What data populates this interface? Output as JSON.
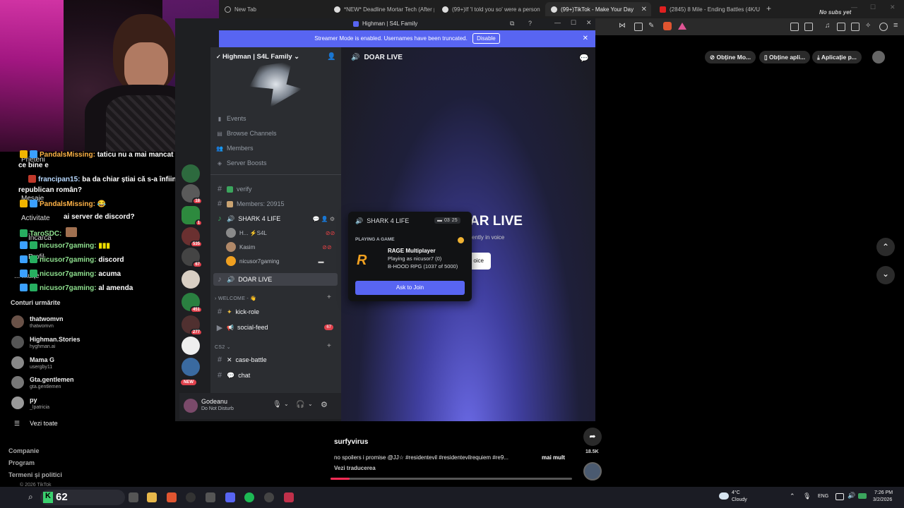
{
  "browser": {
    "tabs": [
      {
        "label": "New Tab",
        "active": false
      },
      {
        "label": "*NEW* Deadline Mortar Tech (After p",
        "active": false
      },
      {
        "label": "(99+)If 'I told you so' were a person",
        "active": false
      },
      {
        "label": "(99+)TikTok - Make Your Day",
        "active": true
      },
      {
        "label": "(2845) 8 Mile - Ending Battles (4K/U",
        "active": false
      }
    ],
    "new_tab": "+",
    "profile_note": "No subs yet"
  },
  "tiktok": {
    "header_links": [
      "Obține Mo...",
      "Obține apli...",
      "Aplicație p..."
    ],
    "username": "surfyvirus",
    "caption": "no spoilers i promise @JJ☆ #residentevil #residentevilrequiem #re9...",
    "more": "mai mult",
    "translate": "Vezi traducerea",
    "share_count": "18.5K"
  },
  "twitch": {
    "sidebar_labels": {
      "friends": "Prieteni",
      "messages": "Mesaje",
      "activity": "Activitate",
      "upload": "Încarcă",
      "profile": "Profil",
      "more": "... mulțe"
    },
    "chat": [
      {
        "user": "PandalsMissing:",
        "text": "taticu nu a mai mancat de cand s-a nascut si ulte",
        "color": "orange"
      },
      {
        "user": "",
        "text": "ce bine e",
        "color": "orange"
      },
      {
        "user": "francipan15:",
        "text": "ba da chiar știai că s-a înființat acum partidul",
        "color": "blue"
      },
      {
        "user": "",
        "text": "republican român?",
        "color": "blue"
      },
      {
        "user": "PandalsMissing:",
        "text": "😂",
        "color": "orange"
      },
      {
        "user": "",
        "text": "ai server de discord?",
        "color": "orange"
      },
      {
        "user": "TaroSDC:",
        "text": "",
        "color": "green"
      },
      {
        "user": "nicusor7gaming:",
        "text": "",
        "color": "green"
      },
      {
        "user": "nicusor7gaming:",
        "text": "discord",
        "color": "green"
      },
      {
        "user": "nicusor7gaming:",
        "text": "acuma",
        "color": "green"
      },
      {
        "user": "nicusor7gaming:",
        "text": "al amenda",
        "color": "green"
      }
    ],
    "follow_header": "Conturi urmărite",
    "following": [
      {
        "name": "thatwomvn",
        "sub": "thatwomvn"
      },
      {
        "name": "Highman.Stories",
        "sub": "hyghman.ai"
      },
      {
        "name": "Mama G",
        "sub": "usergby11"
      },
      {
        "name": "Gta.gentlemen",
        "sub": "gta.gentlemen"
      },
      {
        "name": "py",
        "sub": "_lpatricia"
      }
    ],
    "see_all": "Vezi toate",
    "footer": [
      "Companie",
      "Program",
      "Termeni și politici",
      "© 2026 TikTok"
    ]
  },
  "discord": {
    "window_title": "Highman | S4L Family",
    "streamer_notice": "Streamer Mode is enabled. Usernames have been truncated.",
    "disable_label": "Disable",
    "server_name": "Highman | S4L Family",
    "nav": [
      "Events",
      "Browse Channels",
      "Members",
      "Server Boosts"
    ],
    "channels": {
      "verify": "verify",
      "members": "Members: 20915",
      "voice1": "SHARK 4 LIFE",
      "voice2": "DOAR LIVE",
      "cat_welcome": "WELCOME - 👋",
      "kick": "kick-role",
      "social": "social-feed",
      "social_badge": "67",
      "cat_cs2": "CS2",
      "case": "case-battle",
      "chat": "chat"
    },
    "voice_users": [
      {
        "name": "H... ⚡S4L"
      },
      {
        "name": "Kasim"
      },
      {
        "name": "nicusor7gaming"
      }
    ],
    "guild_badges": [
      "18",
      "1",
      "535",
      "67",
      "451",
      "277",
      "NEW"
    ],
    "user": {
      "name": "Godeanu",
      "status": "Do Not Disturb"
    },
    "main": {
      "header": "DOAR LIVE",
      "big_title": "AR LIVE",
      "subtitle": "ently in voice",
      "join_voice": "oice"
    },
    "popup": {
      "channel": "SHARK 4 LIFE",
      "count": "03",
      "limit": "25",
      "section": "PLAYING A GAME",
      "game": "RAGE Multiplayer",
      "line1": "Playing as nicusor7 (0)",
      "line2": "B-HOOD RPG (1037 of 5000)",
      "button": "Ask to Join"
    }
  },
  "taskbar": {
    "search_count": "62",
    "weather_temp": "4°C",
    "weather_desc": "Cloudy",
    "lang": "ENG",
    "time": "7:26 PM",
    "date": "3/2/2026"
  },
  "colors": {
    "discord_blurple": "#5865f2",
    "badge_red": "#e0414c"
  }
}
